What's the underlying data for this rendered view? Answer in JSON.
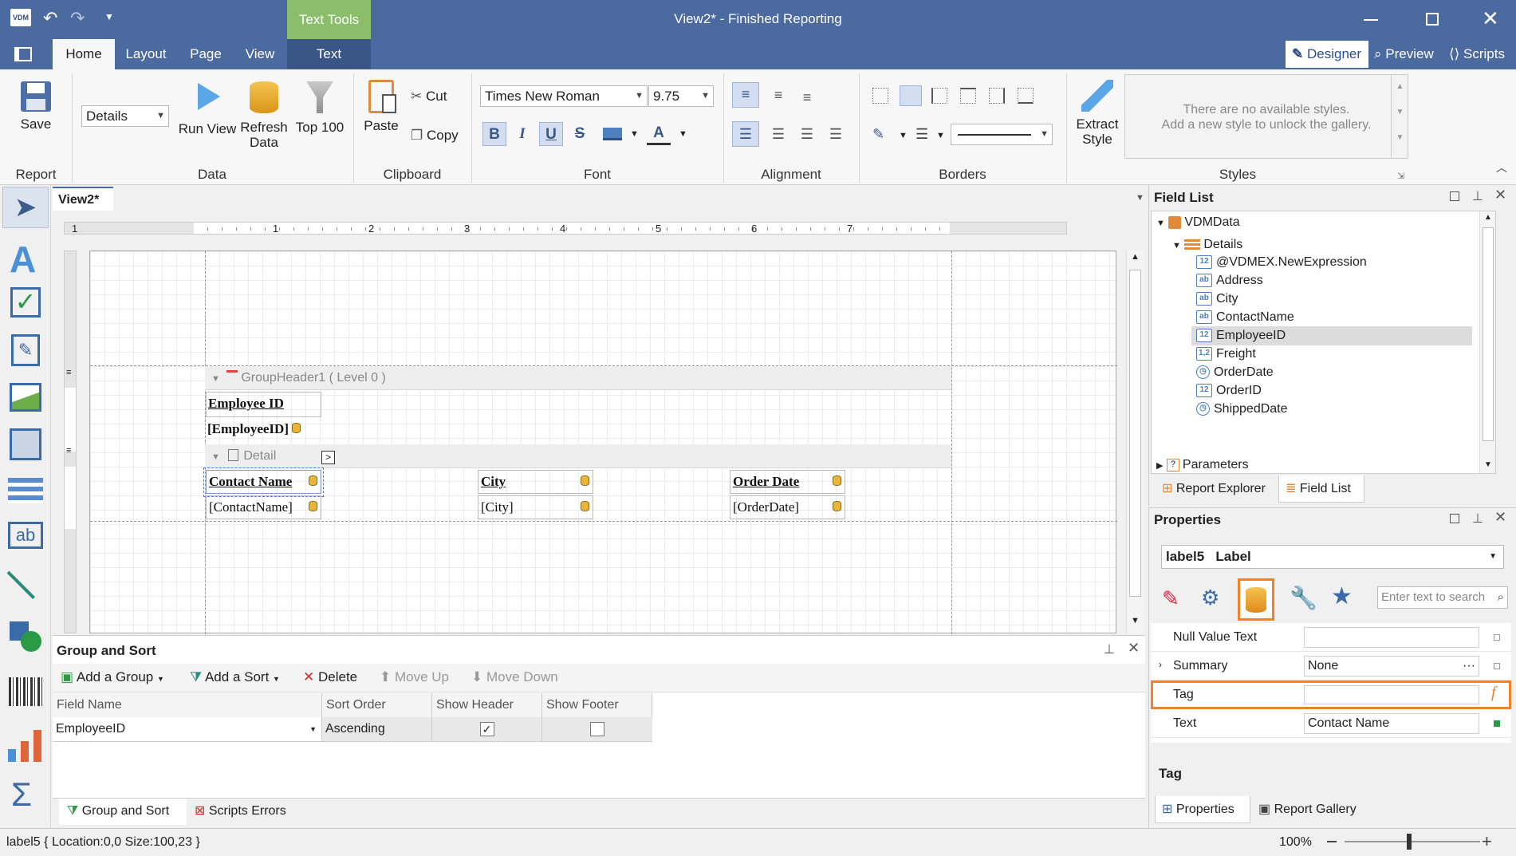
{
  "window": {
    "app_logo": "VDM",
    "title": "View2* - Finished Reporting",
    "context_tab": "Text Tools"
  },
  "tabs": [
    "Home",
    "Layout",
    "Page",
    "View",
    "Text"
  ],
  "right_tabs": {
    "designer": "Designer",
    "preview": "Preview",
    "scripts": "Scripts"
  },
  "ribbon": {
    "report": {
      "save": "Save",
      "group": "Report"
    },
    "data": {
      "combo": "Details",
      "run_view": "Run View",
      "refresh": "Refresh Data",
      "refresh_1": "Refresh",
      "refresh_2": "Data",
      "top100": "Top 100",
      "group": "Data"
    },
    "clipboard": {
      "paste": "Paste",
      "cut": "Cut",
      "copy": "Copy",
      "group": "Clipboard"
    },
    "font": {
      "family": "Times New Roman",
      "size": "9.75",
      "bold": "B",
      "italic": "I",
      "underline": "U",
      "strike": "S",
      "color": "A",
      "group": "Font"
    },
    "alignment": {
      "group": "Alignment"
    },
    "borders": {
      "group": "Borders"
    },
    "styles": {
      "extract_1": "Extract",
      "extract_2": "Style",
      "gallery_line1": "There are no available styles.",
      "gallery_line2": "Add a new style to unlock the gallery.",
      "group": "Styles"
    }
  },
  "document": {
    "tab": "View2*",
    "ruler": [
      "1",
      "1",
      "2",
      "3",
      "4",
      "5",
      "6",
      "7"
    ]
  },
  "bands": {
    "group_header": "GroupHeader1 ( Level 0 )",
    "detail": "Detail"
  },
  "controls": {
    "employee_id_label": "Employee ID",
    "employee_id_field": "[EmployeeID]",
    "contact_name_label": "Contact Name",
    "contact_name_field": "[ContactName]",
    "city_label": "City",
    "city_field": "[City]",
    "order_date_label": "Order Date",
    "order_date_field": "[OrderDate]"
  },
  "group_sort": {
    "title": "Group and Sort",
    "add_group": "Add a Group",
    "add_sort": "Add a Sort",
    "delete": "Delete",
    "move_up": "Move Up",
    "move_down": "Move Down",
    "columns": [
      "Field Name",
      "Sort Order",
      "Show Header",
      "Show Footer"
    ],
    "row": {
      "field": "EmployeeID",
      "order": "Ascending",
      "show_header": true,
      "show_footer": false
    },
    "bottom_tabs": [
      "Group and Sort",
      "Scripts Errors"
    ]
  },
  "field_list": {
    "title": "Field List",
    "root": "VDMData",
    "table": "Details",
    "fields": [
      {
        "name": "@VDMEX.NewExpression",
        "type": "12"
      },
      {
        "name": "Address",
        "type": "ab"
      },
      {
        "name": "City",
        "type": "ab"
      },
      {
        "name": "ContactName",
        "type": "ab"
      },
      {
        "name": "EmployeeID",
        "type": "12"
      },
      {
        "name": "Freight",
        "type": "1,2"
      },
      {
        "name": "OrderDate",
        "type": "clock"
      },
      {
        "name": "OrderID",
        "type": "12"
      },
      {
        "name": "ShippedDate",
        "type": "clock"
      }
    ],
    "parameters": "Parameters",
    "tabs": [
      "Report Explorer",
      "Field List"
    ]
  },
  "properties": {
    "title": "Properties",
    "selector_name": "label5",
    "selector_type": "Label",
    "search_placeholder": "Enter text to search",
    "rows": [
      {
        "name": "Null Value Text",
        "value": ""
      },
      {
        "name": "Summary",
        "value": "None"
      },
      {
        "name": "Tag",
        "value": ""
      },
      {
        "name": "Text",
        "value": "Contact Name"
      }
    ],
    "description_title": "Tag",
    "tabs": [
      "Properties",
      "Report Gallery"
    ]
  },
  "status": {
    "text": "label5 { Location:0,0 Size:100,23 }",
    "zoom": "100%"
  }
}
